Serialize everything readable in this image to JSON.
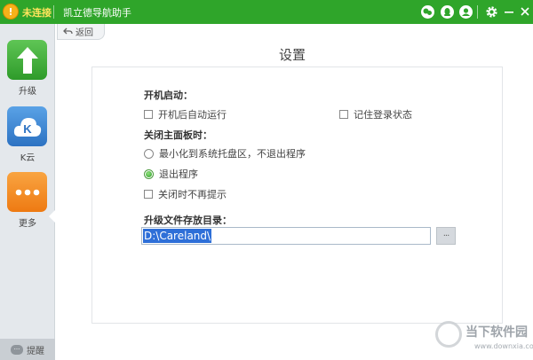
{
  "titlebar": {
    "status_icon": "!",
    "status_text": "未连接",
    "app_title": "凯立德导航助手",
    "icons": [
      "chat-icon",
      "qq-icon",
      "user-icon",
      "gear-icon",
      "minimize-icon",
      "close-icon"
    ]
  },
  "sidebar": {
    "items": [
      {
        "label": "升级",
        "icon": "upgrade-icon",
        "color": "#3fae3a"
      },
      {
        "label": "K云",
        "icon": "k-cloud-icon",
        "color": "#3a84cf"
      },
      {
        "label": "更多",
        "icon": "more-icon",
        "color": "#f28a1e"
      }
    ],
    "footer_label": "提醒",
    "footer_bubble": "···"
  },
  "content": {
    "back_label": "返回",
    "page_title": "设置",
    "startup": {
      "title": "开机启动：",
      "auto_run": "开机后自动运行",
      "remember_login": "记住登录状态"
    },
    "close_panel": {
      "title": "关闭主面板时：",
      "minimize_tray": "最小化到系统托盘区，不退出程序",
      "exit_program": "退出程序",
      "no_prompt": "关闭时不再提示"
    },
    "upgrade_dir": {
      "title": "升级文件存放目录：",
      "value": "D:\\Careland\\",
      "browse_label": "···"
    }
  },
  "watermark": {
    "text": "当下软件园",
    "url": "www.downxia.com"
  },
  "colors": {
    "titlebar_bg": "#2fa52a",
    "sidebar_bg": "#e4e8ec",
    "selection": "#2e6fd8"
  }
}
